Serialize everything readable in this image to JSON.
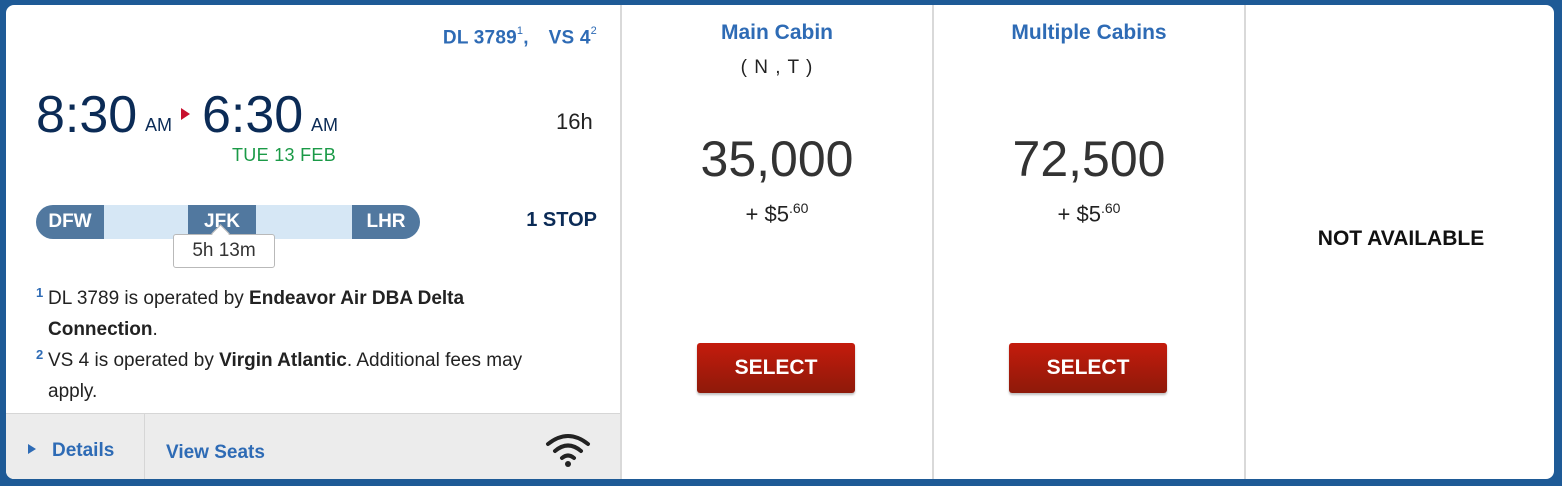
{
  "flight": {
    "number_1": "DL 3789",
    "number_1_ref": "1",
    "separator": ",",
    "number_2": "VS 4",
    "number_2_ref": "2",
    "depart_time": "8:30",
    "depart_ampm": "AM",
    "arrive_time": "6:30",
    "arrive_ampm": "AM",
    "arrive_date": "TUE 13 FEB",
    "duration": "16h",
    "stops": "1 STOP",
    "route": [
      "DFW",
      "JFK",
      "LHR"
    ],
    "layover": "5h 13m"
  },
  "notes": [
    {
      "ref": "1",
      "pre": "DL 3789 is operated by ",
      "bold": "Endeavor Air DBA Delta Connection",
      "post": "."
    },
    {
      "ref": "2",
      "pre": "VS 4 is operated by ",
      "bold": "Virgin Atlantic",
      "post": ". Additional fees may apply."
    }
  ],
  "links": {
    "details": "Details",
    "view_seats": "View Seats"
  },
  "icons": {
    "details": "triangle-right-icon",
    "wifi": "wifi-icon",
    "arrow": "flight-arrow-icon"
  },
  "fares": [
    {
      "cabin": "Main Cabin",
      "codes": "( N , T )",
      "miles": "35,000",
      "tax_prefix": "+ $",
      "tax_int": "5",
      "tax_dec": ".60",
      "button": "SELECT"
    },
    {
      "cabin": "Multiple Cabins",
      "codes": "",
      "miles": "72,500",
      "tax_prefix": "+ $",
      "tax_int": "5",
      "tax_dec": ".60",
      "button": "SELECT"
    },
    {
      "status": "NOT AVAILABLE"
    }
  ],
  "colors": {
    "frame": "#1e5a96",
    "link": "#2e6bb5",
    "time": "#0b2b56",
    "date": "#1b9a47",
    "select": "#b0180a",
    "airport": "#51789f"
  }
}
